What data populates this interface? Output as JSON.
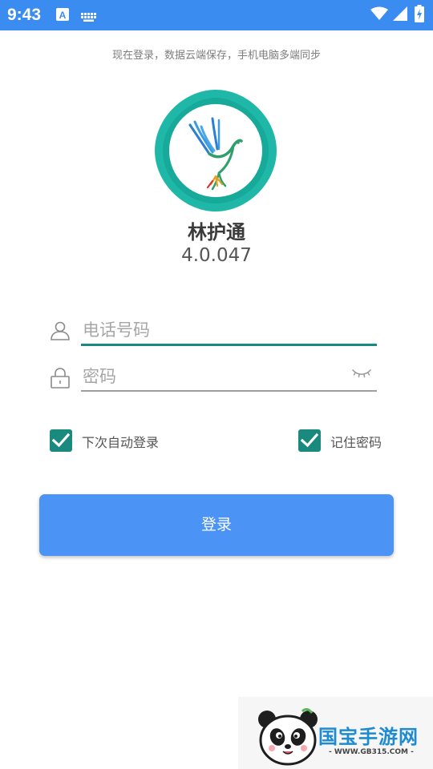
{
  "status_bar": {
    "time": "9:43",
    "left_icons": [
      "a-font-icon",
      "keyboard-icon"
    ],
    "right_icons": [
      "wifi-icon",
      "signal-icon",
      "battery-icon"
    ],
    "background": "#3b8cf0"
  },
  "tagline": "现在登录，数据云端保存，手机电脑多端同步",
  "app": {
    "name": "林护通",
    "version": "4.0.047",
    "logo_icon": "dove-logo-icon",
    "logo_color": "#1fb8a8"
  },
  "form": {
    "phone_placeholder": "电话号码",
    "password_placeholder": "密码",
    "phone_icon": "user-icon",
    "password_icon": "lock-icon",
    "toggle_icon": "eye-closed-icon",
    "accent": "#1a8a7e"
  },
  "options": {
    "auto_login_label": "下次自动登录",
    "auto_login_checked": true,
    "remember_password_label": "记住密码",
    "remember_password_checked": true
  },
  "login_button": {
    "label": "登录",
    "color": "#4b93f4"
  },
  "watermark": {
    "title": "国宝手游网",
    "url": "- WWW.GB315.COM -",
    "icon": "panda-icon"
  }
}
